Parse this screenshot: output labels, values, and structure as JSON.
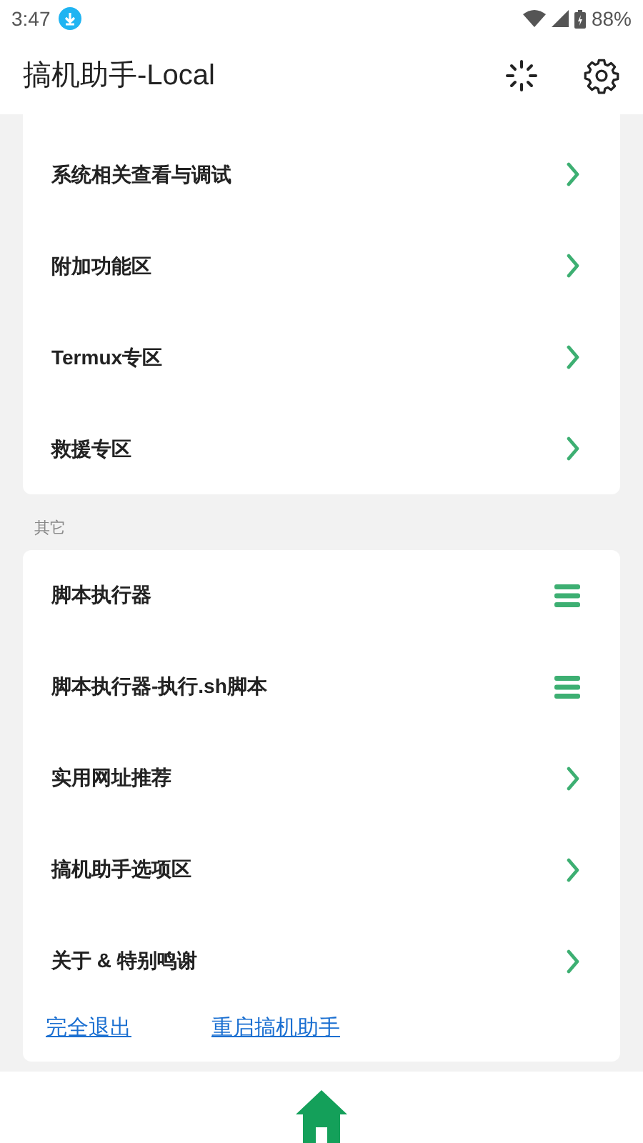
{
  "status_bar": {
    "time": "3:47",
    "battery": "88%"
  },
  "app_bar": {
    "title": "搞机助手-Local"
  },
  "sections": [
    {
      "rows": [
        {
          "label": "系统相关查看与调试",
          "kind": "chevron"
        },
        {
          "label": "附加功能区",
          "kind": "chevron"
        },
        {
          "label": "Termux专区",
          "kind": "chevron"
        },
        {
          "label": "救援专区",
          "kind": "chevron"
        }
      ]
    },
    {
      "header": "其它",
      "rows": [
        {
          "label": "脚本执行器",
          "kind": "menu"
        },
        {
          "label": "脚本执行器-执行.sh脚本",
          "kind": "menu"
        },
        {
          "label": "实用网址推荐",
          "kind": "chevron"
        },
        {
          "label": "搞机助手选项区",
          "kind": "chevron"
        },
        {
          "label": "关于 & 特别鸣谢",
          "kind": "chevron"
        }
      ],
      "links": [
        "完全退出",
        "重启搞机助手"
      ]
    }
  ]
}
